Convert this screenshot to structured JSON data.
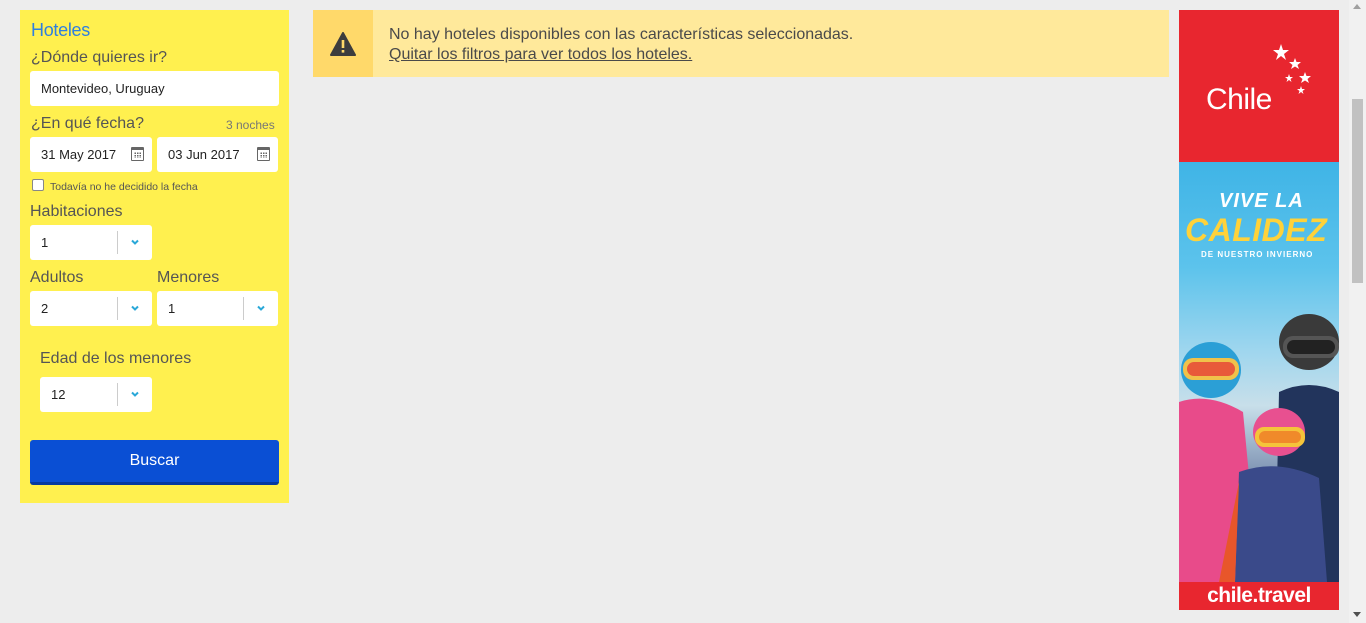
{
  "search": {
    "title": "Hoteles",
    "destination_label": "¿Dónde quieres ir?",
    "destination_value": "Montevideo, Uruguay",
    "date_label": "¿En qué fecha?",
    "nights": "3 noches",
    "checkin": "31 May 2017",
    "checkout": "03 Jun 2017",
    "undecided_label": "Todavía no he decidido la fecha",
    "rooms_label": "Habitaciones",
    "rooms_value": "1",
    "adults_label": "Adultos",
    "adults_value": "2",
    "minors_label": "Menores",
    "minors_value": "1",
    "minors_age_label": "Edad de los menores",
    "minor_age_value": "12",
    "search_button": "Buscar"
  },
  "alert": {
    "message": "No hay hoteles disponibles con las características seleccionadas.",
    "link": "Quitar los filtros para ver todos los hoteles."
  },
  "ad": {
    "brand": "Chile",
    "headline_1": "VIVE LA",
    "headline_2": "CALIDEZ",
    "subline": "DE NUESTRO INVIERNO",
    "footer": "chile.travel"
  },
  "colors": {
    "panel": "#fff04f",
    "primary_button": "#0a4fd4",
    "alert_bg": "#ffe99b",
    "ad_red": "#e8262f",
    "title_blue": "#2f7fe0"
  }
}
